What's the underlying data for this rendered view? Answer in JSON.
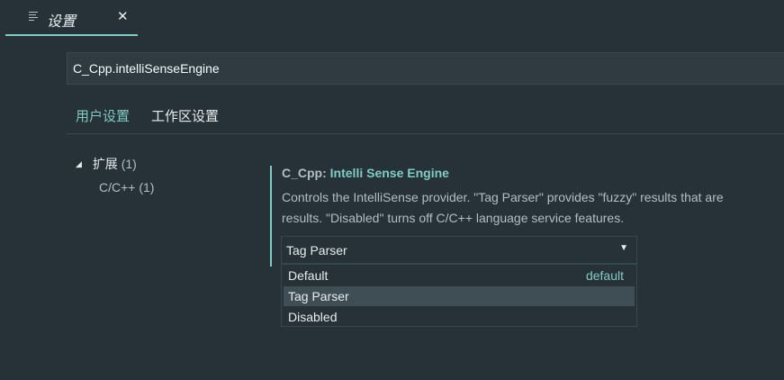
{
  "tab": {
    "title": "设置",
    "icon": "settings-list-icon",
    "close_glyph": "✕"
  },
  "search": {
    "value": "C_Cpp.intelliSenseEngine",
    "placeholder": ""
  },
  "scope_tabs": [
    {
      "label": "用户设置",
      "active": true
    },
    {
      "label": "工作区设置",
      "active": false
    }
  ],
  "toc": {
    "group_label": "扩展",
    "group_count": "(1)",
    "items": [
      {
        "label": "C/C++",
        "count": "(1)"
      }
    ]
  },
  "setting": {
    "category": "C_Cpp: ",
    "key": "Intelli Sense Engine",
    "description_line1": "Controls the IntelliSense provider. \"Tag Parser\" provides \"fuzzy\" results that are",
    "description_line2": "results. \"Disabled\" turns off C/C++ language service features.",
    "selected_value": "Tag Parser",
    "options": [
      {
        "label": "Default",
        "hint": "default",
        "highlighted": false
      },
      {
        "label": "Tag Parser",
        "hint": "",
        "highlighted": true
      },
      {
        "label": "Disabled",
        "hint": "",
        "highlighted": false
      }
    ]
  },
  "colors": {
    "background": "#263238",
    "accent": "#80cbc4",
    "text": "#e6ecef",
    "muted_text": "#b0bec5",
    "highlight": "#3f4d54"
  }
}
